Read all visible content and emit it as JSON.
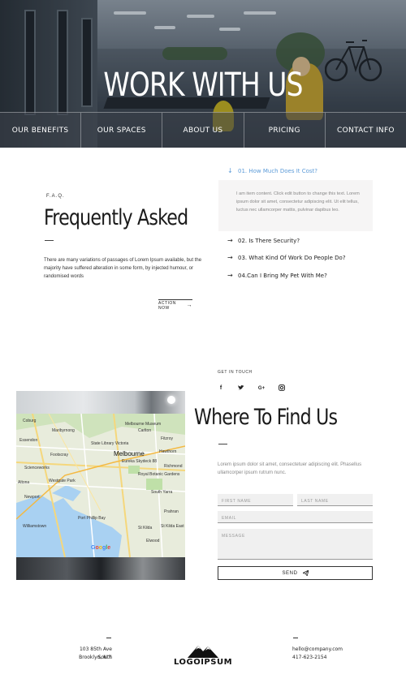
{
  "hero": {
    "title": "WORK WITH US",
    "nav": [
      {
        "label": "OUR BENEFITS"
      },
      {
        "label": "OUR SPACES"
      },
      {
        "label": "ABOUT US"
      },
      {
        "label": "PRICING"
      },
      {
        "label": "CONTACT INFO"
      }
    ]
  },
  "faq": {
    "eyebrow": "F.A.Q.",
    "heading": "Frequently Asked",
    "body": "There are many variations of passages of Lorem Ipsum available, but the majority have suffered alteration in some form, by injected humour, or randomised words",
    "action_label": "ACTION NOW",
    "questions": [
      {
        "label": "01. How Much Does It Cost?",
        "icon": "arrow-down-icon"
      },
      {
        "label": "02. Is There Security?",
        "icon": "arrow-right-icon"
      },
      {
        "label": "03. What Kind Of Work Do People Do?",
        "icon": "arrow-right-icon"
      },
      {
        "label": "04.Can I Bring My Pet With Me?",
        "icon": "arrow-right-icon"
      }
    ],
    "answer": "I am item content. Click edit button to change this text. Lorem ipsum dolor sit amet, consectetur adipiscing elit. Ut elit tellus, luctus nec ullamcorper mattis, pulvinar dapibus leo.",
    "accent_color": "#5c9bd8"
  },
  "contact": {
    "eyebrow": "GET IN TOUCH",
    "socials": [
      "facebook-icon",
      "twitter-icon",
      "google-plus-icon",
      "instagram-icon"
    ],
    "heading": "Where To Find Us",
    "body": "Lorem ipsum dolor sit amet, consectetuer adipiscing elit. Phasellus ullamcorper ipsum rutrum nunc.",
    "fields": {
      "first_name": "FIRST NAME",
      "last_name": "LAST NAME",
      "email": "EMAIL",
      "message": "MESSAGE"
    },
    "send_label": "SEND"
  },
  "map": {
    "cities": [
      {
        "name": "Melbourne",
        "big": true
      },
      {
        "name": "Melbourne Museum"
      },
      {
        "name": "Carlton"
      },
      {
        "name": "Fitzroy"
      },
      {
        "name": "Coburg"
      },
      {
        "name": "Essendon"
      },
      {
        "name": "State Library Victoria"
      },
      {
        "name": "Richmond"
      },
      {
        "name": "Hawthorn"
      },
      {
        "name": "Royal Botanic Gardens"
      },
      {
        "name": "South Yarra"
      },
      {
        "name": "St Kilda"
      },
      {
        "name": "Prahran"
      },
      {
        "name": "Williamstown"
      },
      {
        "name": "Newport"
      },
      {
        "name": "Footscray"
      },
      {
        "name": "Altona"
      },
      {
        "name": "Port Phillip Bay"
      },
      {
        "name": "St Kilda East"
      },
      {
        "name": "Elwood"
      },
      {
        "name": "Maribyrnong"
      },
      {
        "name": "Westgate Park"
      },
      {
        "name": "Eureka Skydeck 88"
      },
      {
        "name": "Scienceworks"
      }
    ],
    "attribution": "Google"
  },
  "footer": {
    "address_line1": "103 85th Ave  South",
    "address_line2": "Brooklyn, N.Y.",
    "logo_text": "LOGOIPSUM",
    "email": "hello@company.com",
    "phone": "417-623-2154"
  }
}
